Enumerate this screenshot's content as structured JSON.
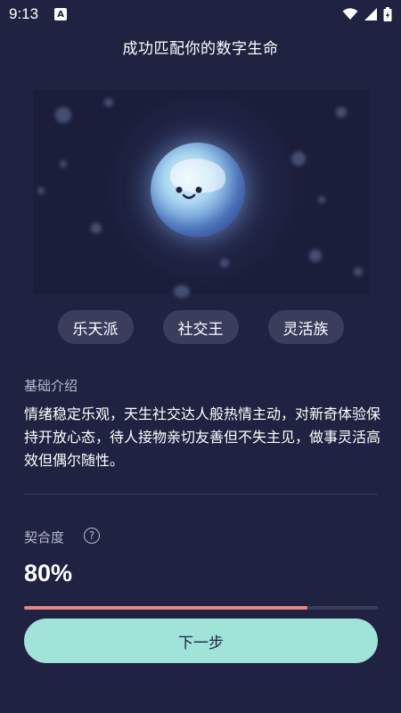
{
  "status_bar": {
    "time": "9:13",
    "notification_letter": "A"
  },
  "page": {
    "title": "成功匹配你的数字生命"
  },
  "tags": [
    "乐天派",
    "社交王",
    "灵活族"
  ],
  "intro": {
    "label": "基础介绍",
    "text": "情绪稳定乐观，天生社交达人般热情主动，对新奇体验保持开放心态，待人接物亲切友善但不失主见，做事灵活高效但偶尔随性。"
  },
  "match": {
    "label": "契合度",
    "help_symbol": "?",
    "percent_text": "80%",
    "progress_fraction": 0.8
  },
  "actions": {
    "next_label": "下一步"
  },
  "colors": {
    "background": "#1f2240",
    "progress": "#e8857c",
    "button": "#9fe3d9"
  },
  "icons": {
    "wifi": "wifi-icon",
    "signal": "signal-icon",
    "battery": "battery-icon",
    "help": "help-icon"
  }
}
